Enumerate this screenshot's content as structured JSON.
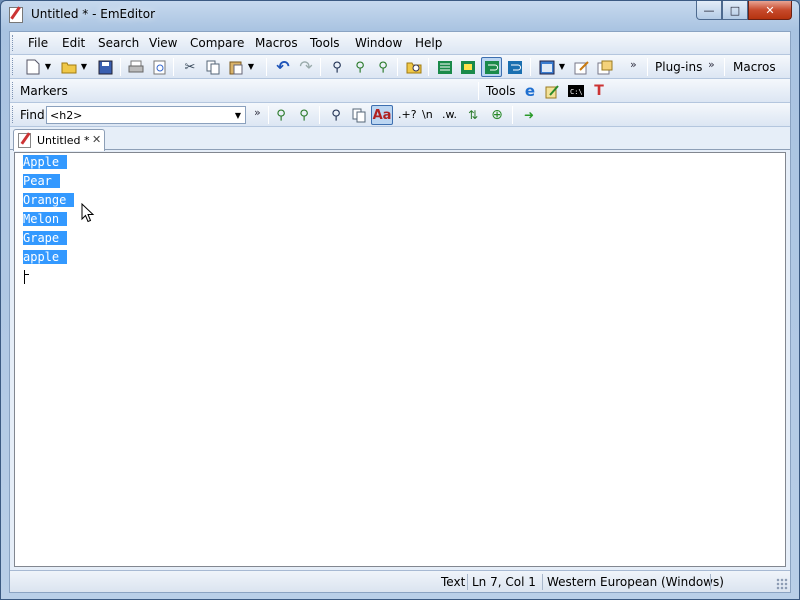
{
  "window": {
    "title": "Untitled * - EmEditor",
    "caption_minimize": "—",
    "caption_maximize": "□",
    "caption_close": "✕"
  },
  "menubar": {
    "items": [
      "File",
      "Edit",
      "Search",
      "View",
      "Compare",
      "Macros",
      "Tools",
      "Window",
      "Help"
    ]
  },
  "toolbar_main": {
    "plugins_label": "Plug-ins",
    "macros_label": "Macros",
    "chevron": "»"
  },
  "toolbar_second": {
    "markers_label": "Markers",
    "tools_label": "Tools"
  },
  "find_bar": {
    "label": "Find",
    "value": "<h2>",
    "chevron": "»",
    "regex_label": ".+?",
    "newline_label": "\\n",
    "word_label": ".w.",
    "arrows_label": "⇅"
  },
  "tab": {
    "label": "Untitled *",
    "close": "✕"
  },
  "editor": {
    "lines": [
      "Apple",
      "Pear",
      "Orange",
      "Melon",
      "Grape",
      "apple"
    ]
  },
  "statusbar": {
    "mode": "Text",
    "position": "Ln 7, Col 1",
    "encoding": "Western European (Windows)"
  },
  "colors": {
    "selection": "#3399ff",
    "close_button": "#c74a2c"
  }
}
